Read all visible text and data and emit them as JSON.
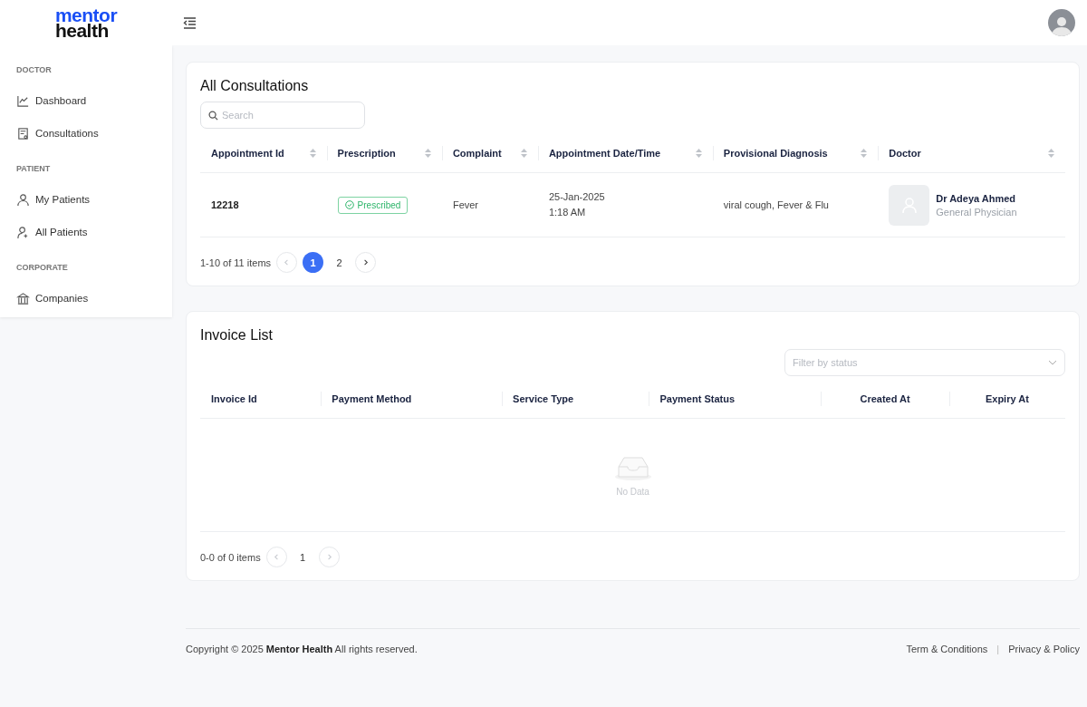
{
  "header": {
    "logo_top": "mentor",
    "logo_bottom": "health"
  },
  "sidebar": {
    "sections": [
      {
        "title": "DOCTOR",
        "items": [
          {
            "label": "Dashboard"
          },
          {
            "label": "Consultations"
          }
        ]
      },
      {
        "title": "PATIENT",
        "items": [
          {
            "label": "My Patients"
          },
          {
            "label": "All Patients"
          }
        ]
      },
      {
        "title": "CORPORATE",
        "items": [
          {
            "label": "Companies"
          }
        ]
      }
    ]
  },
  "consultations": {
    "title": "All Consultations",
    "search": {
      "placeholder": "Search"
    },
    "columns": [
      {
        "label": "Appointment Id",
        "sortable": true
      },
      {
        "label": "Prescription",
        "sortable": true
      },
      {
        "label": "Complaint",
        "sortable": true
      },
      {
        "label": "Appointment Date/Time",
        "sortable": true
      },
      {
        "label": "Provisional Diagnosis",
        "sortable": true
      },
      {
        "label": "Doctor",
        "sortable": true
      }
    ],
    "rows": [
      {
        "appointment_id": "12218",
        "prescription": "Prescribed",
        "complaint": "Fever",
        "date": "25-Jan-2025",
        "time": "1:18 AM",
        "diagnosis": "viral cough, Fever & Flu",
        "doctor_name": "Dr Adeya Ahmed",
        "doctor_role": "General Physician"
      }
    ],
    "pagination": {
      "summary": "1-10 of 11 items",
      "prev_disabled": true,
      "next_disabled": false,
      "pages": [
        {
          "label": "1",
          "selected": true
        },
        {
          "label": "2",
          "selected": false
        }
      ]
    }
  },
  "invoices": {
    "title": "Invoice List",
    "filter": {
      "placeholder": "Filter by status"
    },
    "columns": [
      "Invoice Id",
      "Payment Method",
      "Service Type",
      "Payment Status",
      "Created At",
      "Expiry At"
    ],
    "empty_text": "No Data",
    "pagination": {
      "summary": "0-0 of 0 items",
      "prev_disabled": true,
      "next_disabled": true,
      "pages": [
        {
          "label": "1",
          "selected": false
        }
      ]
    }
  },
  "footer": {
    "copyright": "Copyright © 2025 **Mentor Health** All rights reserved.",
    "links": [
      "Term & Conditions",
      "Privacy & Policy"
    ],
    "separator": "|"
  }
}
